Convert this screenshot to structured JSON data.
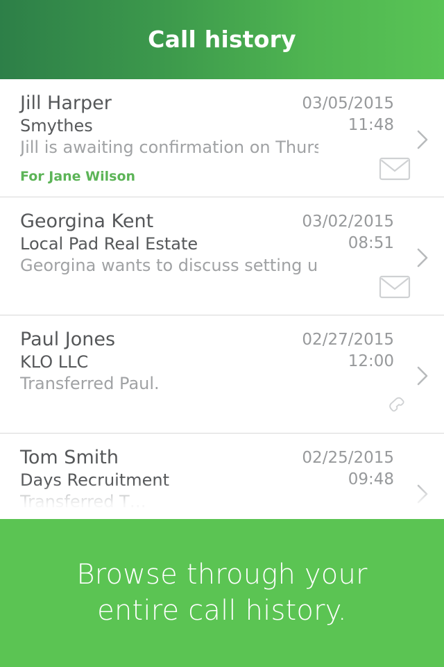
{
  "header": {
    "title": "Call history",
    "gradient_from": "#2d7f48",
    "gradient_to": "#59c455"
  },
  "banner": {
    "line1": "Browse through your",
    "line2": "entire call history.",
    "background": "#5bc453",
    "text_color": "#ffffff"
  },
  "colors": {
    "accent_green": "#5cb457",
    "name_text": "#555759",
    "preview_text": "#a0a2a4",
    "meta_text": "#97999b",
    "icon_grey": "#cfd1d3",
    "divider": "#d8d8d8"
  },
  "calls": [
    {
      "name": "Jill Harper",
      "company": "Smythes",
      "preview": "Jill is awaiting confirmation on Thursday’s…",
      "tag": "For Jane Wilson",
      "date": "03/05/2015",
      "time": "11:48",
      "type_icon": "envelope-icon",
      "chevron": "chevron-right-icon"
    },
    {
      "name": "Georgina Kent",
      "company": "Local Pad Real Estate",
      "preview": "Georgina wants to discuss setting up a trial…",
      "tag": "",
      "date": "03/02/2015",
      "time": "08:51",
      "type_icon": "envelope-icon",
      "chevron": "chevron-right-icon"
    },
    {
      "name": "Paul Jones",
      "company": "KLO LLC",
      "preview": "Transferred Paul.",
      "tag": "",
      "date": "02/27/2015",
      "time": "12:00",
      "type_icon": "phone-icon",
      "chevron": "chevron-right-icon"
    },
    {
      "name": "Tom Smith",
      "company": "Days Recruitment",
      "preview": "Transferred T…",
      "tag": "",
      "date": "02/25/2015",
      "time": "09:48",
      "type_icon": "",
      "chevron": "chevron-right-icon"
    }
  ]
}
